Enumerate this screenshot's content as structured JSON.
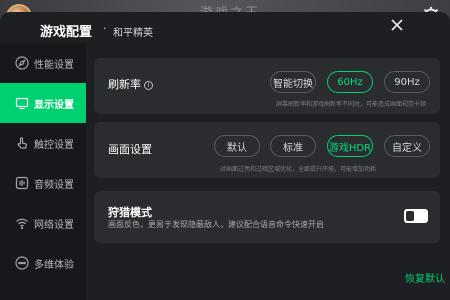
{
  "background": {
    "ghost_text": "游戏之王"
  },
  "header": {
    "title": "游戏配置",
    "separator": "·",
    "game_name": "和平精英"
  },
  "sidebar": {
    "items": [
      {
        "label": "性能设置",
        "icon": "compass-icon"
      },
      {
        "label": "显示设置",
        "icon": "display-icon",
        "active": true
      },
      {
        "label": "触控设置",
        "icon": "touch-icon"
      },
      {
        "label": "音频设置",
        "icon": "audio-icon"
      },
      {
        "label": "网络设置",
        "icon": "wifi-icon"
      },
      {
        "label": "多维体验",
        "icon": "more-icon"
      }
    ]
  },
  "refresh_rate": {
    "label": "刷新率",
    "info": "i",
    "options": [
      "智能切换",
      "60Hz",
      "90Hz"
    ],
    "selected": "60Hz",
    "hint": "屏幕刷新率和游戏刷新率不同时，可能造成画面视觉卡顿"
  },
  "picture": {
    "label": "画面设置",
    "options": [
      "默认",
      "标准",
      "游戏HDR",
      "自定义"
    ],
    "selected": "游戏HDR",
    "hint": "对画面过亮和过暗区域优化，全面提升环境，可能增加功耗"
  },
  "sniper": {
    "title": "狩猎模式",
    "desc": "画面反色，更易于发现隐蔽敌人，建议配合语音命令快速开启",
    "enabled": false
  },
  "footer": {
    "restore_label": "恢复默认"
  },
  "colors": {
    "accent": "#00d170",
    "panel": "#1e1f23",
    "card": "#2b2c30",
    "sidebar": "#17181b"
  }
}
